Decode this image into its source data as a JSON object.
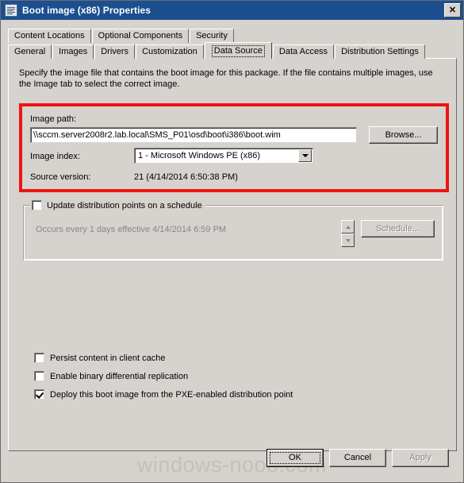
{
  "window": {
    "title": "Boot image (x86) Properties",
    "icon": "properties-document-icon",
    "close_label": "✕",
    "titlebar_color": "#1c4f8f",
    "dialog_background": "#d6d3ce"
  },
  "tabs": {
    "row1": [
      {
        "label": "Content Locations",
        "selected": false
      },
      {
        "label": "Optional Components",
        "selected": false
      },
      {
        "label": "Security",
        "selected": false
      }
    ],
    "row2": [
      {
        "label": "General",
        "selected": false
      },
      {
        "label": "Images",
        "selected": false
      },
      {
        "label": "Drivers",
        "selected": false
      },
      {
        "label": "Customization",
        "selected": false
      },
      {
        "label": "Data Source",
        "selected": true
      },
      {
        "label": "Data Access",
        "selected": false
      },
      {
        "label": "Distribution Settings",
        "selected": false
      }
    ]
  },
  "page": {
    "description": "Specify the image file that contains the boot image for this package. If the file contains multiple images, use the Image tab to select the correct image.",
    "highlight_color": "#f01313",
    "image_path": {
      "label": "Image path:",
      "value": "\\\\sccm.server2008r2.lab.local\\SMS_P01\\osd\\boot\\i386\\boot.wim",
      "browse_label": "Browse..."
    },
    "image_index": {
      "label": "Image index:",
      "value": "1 - Microsoft Windows PE (x86)",
      "arrow_icon": "chevron-down-icon"
    },
    "source_version": {
      "label": "Source version:",
      "value": "21 (4/14/2014 6:50:38 PM)"
    },
    "schedule": {
      "checkbox_label": "Update distribution points on a schedule",
      "checked": false,
      "occurs_text": "Occurs every 1 days effective 4/14/2014 6:59 PM",
      "button_label": "Schedule...",
      "button_disabled": true,
      "spinner_up_icon": "arrow-up-icon",
      "spinner_down_icon": "arrow-down-icon"
    },
    "options": [
      {
        "label": "Persist content in client cache",
        "checked": false
      },
      {
        "label": "Enable binary differential replication",
        "checked": false
      },
      {
        "label": "Deploy this boot image from the PXE-enabled distribution point",
        "checked": true
      }
    ]
  },
  "buttons": {
    "ok": "OK",
    "cancel": "Cancel",
    "apply": "Apply",
    "apply_disabled": true
  },
  "watermark": "windows-noob.com"
}
